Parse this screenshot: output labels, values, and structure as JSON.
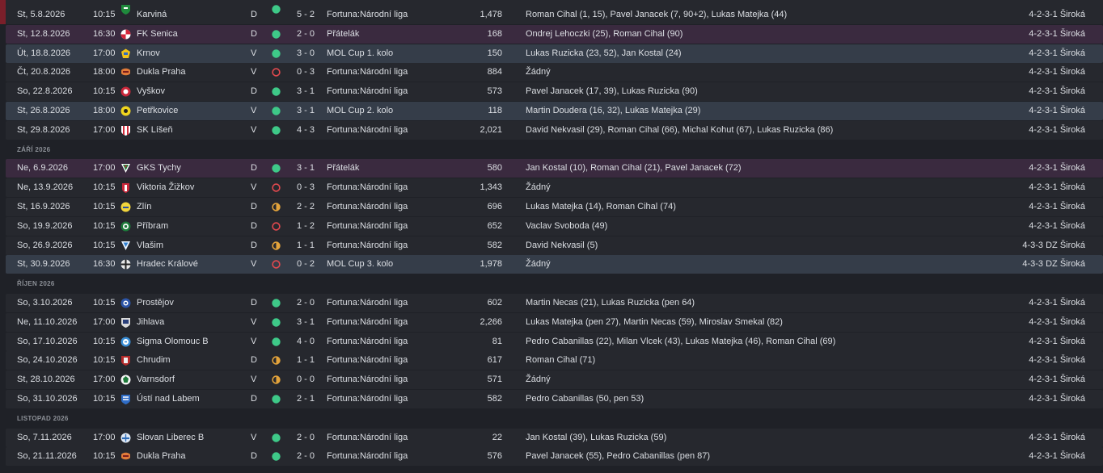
{
  "colors": {
    "win": "#3ec988",
    "draw": "#e3a33b",
    "loss": "#e2494e",
    "row_league": "#26282e",
    "row_friendly": "#3a2a3f",
    "row_cup": "#353d49"
  },
  "months": [
    "ZÁŘÍ 2026",
    "ŘÍJEN 2026",
    "LISTOPAD 2026"
  ],
  "fixtures": [
    {
      "date": "St, 5.8.2026",
      "time": "10:15",
      "crest": "green-shield-crest",
      "team": "Karviná",
      "venue": "D",
      "result": "win",
      "score": "5 - 2",
      "competition": "Fortuna:Národní liga",
      "attendance": "1,478",
      "scorers": "Roman Cihal (1, 15), Pavel Janacek (7, 90+2), Lukas Matejka (44)",
      "formation": "4-2-3-1 Široká",
      "kind": "league"
    },
    {
      "date": "St, 12.8.2026",
      "time": "16:30",
      "crest": "red-white-crest",
      "team": "FK Senica",
      "venue": "D",
      "result": "win",
      "score": "2 - 0",
      "competition": "Přátelák",
      "attendance": "168",
      "scorers": "Ondrej Lehoczki (25), Roman Cihal (90)",
      "formation": "4-2-3-1 Široká",
      "kind": "friendly"
    },
    {
      "date": "Út, 18.8.2026",
      "time": "17:00",
      "crest": "yellow-blue-crest",
      "team": "Krnov",
      "venue": "V",
      "result": "win",
      "score": "3 - 0",
      "competition": "MOL Cup 1. kolo",
      "attendance": "150",
      "scorers": "Lukas Ruzicka (23, 52), Jan Kostal (24)",
      "formation": "4-2-3-1 Široká",
      "kind": "cup"
    },
    {
      "date": "Čt, 20.8.2026",
      "time": "18:00",
      "crest": "orange-dukla-crest",
      "team": "Dukla Praha",
      "venue": "V",
      "result": "loss",
      "score": "0 - 3",
      "competition": "Fortuna:Národní liga",
      "attendance": "884",
      "scorers": "Žádný",
      "formation": "4-2-3-1 Široká",
      "kind": "league"
    },
    {
      "date": "So, 22.8.2026",
      "time": "10:15",
      "crest": "red-round-crest",
      "team": "Vyškov",
      "venue": "D",
      "result": "win",
      "score": "3 - 1",
      "competition": "Fortuna:Národní liga",
      "attendance": "573",
      "scorers": "Pavel Janacek (17, 39), Lukas Ruzicka (90)",
      "formation": "4-2-3-1 Široká",
      "kind": "league"
    },
    {
      "date": "St, 26.8.2026",
      "time": "18:00",
      "crest": "yellow-ball-crest",
      "team": "Petřkovice",
      "venue": "V",
      "result": "win",
      "score": "3 - 1",
      "competition": "MOL Cup 2. kolo",
      "attendance": "118",
      "scorers": "Martin Doudera (16, 32), Lukas Matejka (29)",
      "formation": "4-2-3-1 Široká",
      "kind": "cup"
    },
    {
      "date": "St, 29.8.2026",
      "time": "17:00",
      "crest": "red-stripes-crest",
      "team": "SK Líšeň",
      "venue": "V",
      "result": "win",
      "score": "4 - 3",
      "competition": "Fortuna:Národní liga",
      "attendance": "2,021",
      "scorers": "David Nekvasil (29), Roman Cihal (66), Michal Kohut (67), Lukas Ruzicka (86)",
      "formation": "4-2-3-1 Široká",
      "kind": "league"
    },
    {
      "date": "Ne, 6.9.2026",
      "time": "17:00",
      "crest": "tychy-crest",
      "team": "GKS Tychy",
      "venue": "D",
      "result": "win",
      "score": "3 - 1",
      "competition": "Přátelák",
      "attendance": "580",
      "scorers": "Jan Kostal (10), Roman Cihal (21), Pavel Janacek (72)",
      "formation": "4-2-3-1 Široká",
      "kind": "friendly"
    },
    {
      "date": "Ne, 13.9.2026",
      "time": "10:15",
      "crest": "viktoria-crest",
      "team": "Viktoria Žižkov",
      "venue": "V",
      "result": "loss",
      "score": "0 - 3",
      "competition": "Fortuna:Národní liga",
      "attendance": "1,343",
      "scorers": "Žádný",
      "formation": "4-2-3-1 Široká",
      "kind": "league"
    },
    {
      "date": "St, 16.9.2026",
      "time": "10:15",
      "crest": "zlin-crest",
      "team": "Zlín",
      "venue": "D",
      "result": "draw",
      "score": "2 - 2",
      "competition": "Fortuna:Národní liga",
      "attendance": "696",
      "scorers": "Lukas Matejka (14), Roman Cihal (74)",
      "formation": "4-2-3-1 Široká",
      "kind": "league"
    },
    {
      "date": "So, 19.9.2026",
      "time": "10:15",
      "crest": "pribram-crest",
      "team": "Příbram",
      "venue": "D",
      "result": "loss",
      "score": "1 - 2",
      "competition": "Fortuna:Národní liga",
      "attendance": "652",
      "scorers": "Vaclav Svoboda (49)",
      "formation": "4-2-3-1 Široká",
      "kind": "league"
    },
    {
      "date": "So, 26.9.2026",
      "time": "10:15",
      "crest": "vlasim-crest",
      "team": "Vlašim",
      "venue": "D",
      "result": "draw",
      "score": "1 - 1",
      "competition": "Fortuna:Národní liga",
      "attendance": "582",
      "scorers": "David Nekvasil (5)",
      "formation": "4-3-3 DZ Široká",
      "kind": "league"
    },
    {
      "date": "St, 30.9.2026",
      "time": "16:30",
      "crest": "hradec-crest",
      "team": "Hradec Králové",
      "venue": "V",
      "result": "loss",
      "score": "0 - 2",
      "competition": "MOL Cup 3. kolo",
      "attendance": "1,978",
      "scorers": "Žádný",
      "formation": "4-3-3 DZ Široká",
      "kind": "cup"
    },
    {
      "date": "So, 3.10.2026",
      "time": "10:15",
      "crest": "prostejov-crest",
      "team": "Prostějov",
      "venue": "D",
      "result": "win",
      "score": "2 - 0",
      "competition": "Fortuna:Národní liga",
      "attendance": "602",
      "scorers": "Martin Necas (21), Lukas Ruzicka (pen 64)",
      "formation": "4-2-3-1 Široká",
      "kind": "league"
    },
    {
      "date": "Ne, 11.10.2026",
      "time": "17:00",
      "crest": "jihlava-crest",
      "team": "Jihlava",
      "venue": "V",
      "result": "win",
      "score": "3 - 1",
      "competition": "Fortuna:Národní liga",
      "attendance": "2,266",
      "scorers": "Lukas Matejka (pen 27), Martin Necas (59), Miroslav Smekal (82)",
      "formation": "4-2-3-1 Široká",
      "kind": "league"
    },
    {
      "date": "So, 17.10.2026",
      "time": "10:15",
      "crest": "sigma-crest",
      "team": "Sigma Olomouc B",
      "venue": "V",
      "result": "win",
      "score": "4 - 0",
      "competition": "Fortuna:Národní liga",
      "attendance": "81",
      "scorers": "Pedro Cabanillas (22), Milan Vlcek (43), Lukas Matejka (46), Roman Cihal (69)",
      "formation": "4-2-3-1 Široká",
      "kind": "league"
    },
    {
      "date": "So, 24.10.2026",
      "time": "10:15",
      "crest": "chrudim-crest",
      "team": "Chrudim",
      "venue": "D",
      "result": "draw",
      "score": "1 - 1",
      "competition": "Fortuna:Národní liga",
      "attendance": "617",
      "scorers": "Roman Cihal (71)",
      "formation": "4-2-3-1 Široká",
      "kind": "league"
    },
    {
      "date": "St, 28.10.2026",
      "time": "17:00",
      "crest": "varnsdorf-crest",
      "team": "Varnsdorf",
      "venue": "V",
      "result": "draw",
      "score": "0 - 0",
      "competition": "Fortuna:Národní liga",
      "attendance": "571",
      "scorers": "Žádný",
      "formation": "4-2-3-1 Široká",
      "kind": "league"
    },
    {
      "date": "So, 31.10.2026",
      "time": "10:15",
      "crest": "usti-crest",
      "team": "Ústí nad Labem",
      "venue": "D",
      "result": "win",
      "score": "2 - 1",
      "competition": "Fortuna:Národní liga",
      "attendance": "582",
      "scorers": "Pedro Cabanillas (50, pen 53)",
      "formation": "4-2-3-1 Široká",
      "kind": "league"
    },
    {
      "date": "So, 7.11.2026",
      "time": "17:00",
      "crest": "liberec-crest",
      "team": "Slovan Liberec B",
      "venue": "V",
      "result": "win",
      "score": "2 - 0",
      "competition": "Fortuna:Národní liga",
      "attendance": "22",
      "scorers": "Jan Kostal (39), Lukas Ruzicka (59)",
      "formation": "4-2-3-1 Široká",
      "kind": "league"
    },
    {
      "date": "So, 21.11.2026",
      "time": "10:15",
      "crest": "orange-dukla-crest",
      "team": "Dukla Praha",
      "venue": "D",
      "result": "win",
      "score": "2 - 0",
      "competition": "Fortuna:Národní liga",
      "attendance": "576",
      "scorers": "Pavel Janacek (55), Pedro Cabanillas (pen 87)",
      "formation": "4-2-3-1 Široká",
      "kind": "league"
    }
  ]
}
